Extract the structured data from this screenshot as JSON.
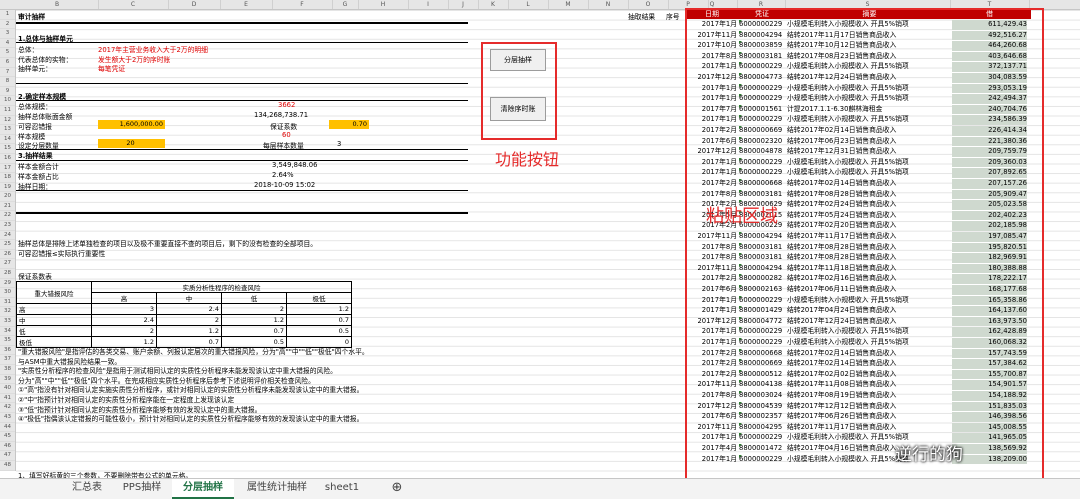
{
  "columns_left": [
    "B",
    "C",
    "D",
    "E",
    "F",
    "G",
    "H",
    "I",
    "J",
    "K",
    "L",
    "M",
    "N",
    "O",
    "P"
  ],
  "columns_right": [
    "Q",
    "R",
    "S",
    "T"
  ],
  "rows": [
    "1",
    "2",
    "3",
    "4",
    "5",
    "6",
    "7",
    "8",
    "9",
    "10",
    "11",
    "12",
    "13",
    "14",
    "15",
    "16",
    "17",
    "18",
    "19",
    "20",
    "21",
    "22",
    "23",
    "24",
    "25",
    "26",
    "27",
    "28",
    "29",
    "30",
    "31",
    "32",
    "33",
    "34",
    "35",
    "36",
    "37",
    "38",
    "39",
    "40",
    "41",
    "42",
    "43",
    "44",
    "45",
    "46",
    "47",
    "48"
  ],
  "left": {
    "title": "审计抽样",
    "sec1": "1.总体与抽样单元",
    "pop_label": "总体：",
    "pop_value": "2017年主营业务收入大于2万的明细",
    "rep_label": "代表总体的实物：",
    "rep_value": "发生额大于2万的序时账",
    "unit_label": "抽样单元：",
    "unit_value": "每笔凭证",
    "sec2": "2.确定样本规模",
    "size_label": "总体规模：",
    "size_value": "3662",
    "amount_label": "抽样总体账面金额",
    "amount_value": "134,268,738.71",
    "tol_label": "可容忍错报",
    "tol_value": "1,600,000.00",
    "conf_label": "保证系数",
    "conf_value": "0.70",
    "sample_label": "样本规模",
    "sample_value": "60",
    "layers_label": "设定分层数量",
    "layers_value": "20",
    "per_layer_label": "每层样本数量",
    "per_layer_value": "3",
    "sec3": "3.抽样结果",
    "total_label": "样本金额合计",
    "total_value": "3,549,848.06",
    "ratio_label": "样本金额占比",
    "ratio_value": "2.64%",
    "date_label": "抽样日期：",
    "date_value": "2018-10-09 15:02",
    "note1": "抽样总体是排除上述单独检查的项目以及极不重要直接不查的项目后，剩下的没有检查的全部项目。",
    "note2": "可容忍错报≤实际执行重要性",
    "table_caption": "保证系数表",
    "risk": {
      "row_header": "重大错报风险",
      "group_header": "实质分析性程序的检查风险",
      "cols": [
        "高",
        "中",
        "低",
        "极低"
      ],
      "rows": [
        {
          "name": "高",
          "vals": [
            "3",
            "2.4",
            "2",
            "1.2"
          ]
        },
        {
          "name": "中",
          "vals": [
            "2.4",
            "2",
            "1.2",
            "0.7"
          ]
        },
        {
          "name": "低",
          "vals": [
            "2",
            "1.2",
            "0.7",
            "0.5"
          ]
        },
        {
          "name": "极低",
          "vals": [
            "1.2",
            "0.7",
            "0.5",
            "0"
          ]
        }
      ]
    },
    "notes": [
      "\"重大错报风险\"是指评估的各类交易、账户余额、列报认定层次的重大错报风险，分为\"高\"\"中\"\"低\"\"极低\"四个水平。",
      "与ASM中重大错报风险结果一致。",
      "\"实质性分析程序的检查风险\"是指用于测试相同认定的实质性分析程序未能发现该认定中重大错报的风险。",
      "分为\"高\"\"中\"\"低\"\"极低\"四个水平。在完成相应实质性分析程序后参考下述说明评价相关检查风险。",
      "①\"高\"指没有针对相同认定实施实质性分析程序，或针对相同认定的实质性分析程序未能发现该认定中的重大错报。",
      "②\"中\"指预计针对相同认定的实质性分析程序能在一定程度上发现该认定",
      "③\"低\"指预计针对相同认定的实质性分析程序能够有效的发现认定中的重大错报。",
      "④\"极低\"指偶该认定错报的可能性极小，预计针对相同认定的实质性分析程序能够有效的发现该认定中的重大错报。"
    ],
    "bottom_note": "1、填写好标黄的三个参数，不要删除带有公式的单元格。"
  },
  "buttons": {
    "layered": "分层抽样",
    "clear": "清除序时账"
  },
  "annotations": {
    "buttons_label": "功能按钮",
    "paste_label": "粘贴区域"
  },
  "result_header": {
    "result": "抽取结果",
    "seq": "序号"
  },
  "journal": {
    "headers": [
      "日期",
      "凭证",
      "摘要",
      "借"
    ],
    "rows": [
      {
        "date": "2017年1月",
        "voucher": "6000000229",
        "summary": "小规模毛利转入小规模收入 开具5%销项",
        "amount": "611,429.43"
      },
      {
        "date": "2017年11月",
        "voucher": "8800004294",
        "summary": "结转2017年11月17日销售商品收入",
        "amount": "492,516.27"
      },
      {
        "date": "2017年10月",
        "voucher": "8800003859",
        "summary": "结转2017年10月12日销售商品收入",
        "amount": "464,260.68"
      },
      {
        "date": "2017年8月",
        "voucher": "8800003181",
        "summary": "结转2017年08月23日销售商品收入",
        "amount": "403,646.68"
      },
      {
        "date": "2017年1月",
        "voucher": "6000000229",
        "summary": "小规模毛利转入小规模收入 开具5%销项",
        "amount": "372,137.71"
      },
      {
        "date": "2017年12月",
        "voucher": "8800004773",
        "summary": "结转2017年12月24日销售商品收入",
        "amount": "304,083.59"
      },
      {
        "date": "2017年1月",
        "voucher": "6000000229",
        "summary": "小规模毛利转入小规模收入 开具5%销项",
        "amount": "293,053.19"
      },
      {
        "date": "2017年1月",
        "voucher": "6000000229",
        "summary": "小规模毛利转入小规模收入 开具5%销项",
        "amount": "242,494.37"
      },
      {
        "date": "2017年7月",
        "voucher": "6000001561",
        "summary": "计提2017.1.1-6.30麒林海租金",
        "amount": "240,704.76"
      },
      {
        "date": "2017年1月",
        "voucher": "6000000229",
        "summary": "小规模毛利转入小规模收入 开具5%销项",
        "amount": "234,586.39"
      },
      {
        "date": "2017年2月",
        "voucher": "8800000669",
        "summary": "结转2017年02月14日销售商品收入",
        "amount": "226,414.34"
      },
      {
        "date": "2017年6月",
        "voucher": "8800002320",
        "summary": "结转2017年06月23日销售商品收入",
        "amount": "221,380.36"
      },
      {
        "date": "2017年12月",
        "voucher": "8800004878",
        "summary": "结转2017年12月31日销售商品收入",
        "amount": "209,759.79"
      },
      {
        "date": "2017年1月",
        "voucher": "6000000229",
        "summary": "小规模毛利转入小规模收入 开具5%销项",
        "amount": "209,360.03"
      },
      {
        "date": "2017年1月",
        "voucher": "6000000229",
        "summary": "小规模毛利转入小规模收入 开具5%销项",
        "amount": "207,892.65"
      },
      {
        "date": "2017年2月",
        "voucher": "8800000668",
        "summary": "结转2017年02月14日销售商品收入",
        "amount": "207,157.26"
      },
      {
        "date": "2017年8月",
        "voucher": "8800003181",
        "summary": "结转2017年08月28日销售商品收入",
        "amount": "205,909.47"
      },
      {
        "date": "2017年2月",
        "voucher": "8800000629",
        "summary": "结转2017年02月24日销售商品收入",
        "amount": "205,023.58"
      },
      {
        "date": "2017年5月",
        "voucher": "8800002015",
        "summary": "结转2017年05月24日销售商品收入",
        "amount": "202,402.23"
      },
      {
        "date": "2017年2月",
        "voucher": "6000000229",
        "summary": "结转2017年02月20日销售商品收入",
        "amount": "202,185.98"
      },
      {
        "date": "2017年11月",
        "voucher": "8800004294",
        "summary": "结转2017年11月17日销售商品收入",
        "amount": "197,085.47"
      },
      {
        "date": "2017年8月",
        "voucher": "8800003181",
        "summary": "结转2017年08月28日销售商品收入",
        "amount": "195,820.51"
      },
      {
        "date": "2017年8月",
        "voucher": "8800003181",
        "summary": "结转2017年08月28日销售商品收入",
        "amount": "182,969.91"
      },
      {
        "date": "2017年11月",
        "voucher": "8800004294",
        "summary": "结转2017年11月18日销售商品收入",
        "amount": "180,388.88"
      },
      {
        "date": "2017年2月",
        "voucher": "8800000282",
        "summary": "结转2017年02月16日销售商品收入",
        "amount": "178,222.17"
      },
      {
        "date": "2017年6月",
        "voucher": "8800002163",
        "summary": "结转2017年06月11日销售商品收入",
        "amount": "168,177.68"
      },
      {
        "date": "2017年1月",
        "voucher": "6000000229",
        "summary": "小规模毛利转入小规模收入 开具5%销项",
        "amount": "165,358.86"
      },
      {
        "date": "2017年1月",
        "voucher": "8800001429",
        "summary": "结转2017年04月24日销售商品收入",
        "amount": "164,137.60"
      },
      {
        "date": "2017年12月",
        "voucher": "8800004772",
        "summary": "结转2017年12月24日销售商品收入",
        "amount": "163,973.50"
      },
      {
        "date": "2017年1月",
        "voucher": "6000000229",
        "summary": "小规模毛利转入小规模收入 开具5%销项",
        "amount": "162,428.89"
      },
      {
        "date": "2017年1月",
        "voucher": "6000000229",
        "summary": "小规模毛利转入小规模收入 开具5%销项",
        "amount": "160,068.32"
      },
      {
        "date": "2017年2月",
        "voucher": "8800000668",
        "summary": "结转2017年02月14日销售商品收入",
        "amount": "157,743.59"
      },
      {
        "date": "2017年2月",
        "voucher": "8800000669",
        "summary": "结转2017年02月14日销售商品收入",
        "amount": "157,384.62"
      },
      {
        "date": "2017年2月",
        "voucher": "8800000512",
        "summary": "结转2017年02月02日销售商品收入",
        "amount": "155,700.87"
      },
      {
        "date": "2017年11月",
        "voucher": "8800004138",
        "summary": "结转2017年11月08日销售商品收入",
        "amount": "154,901.57"
      },
      {
        "date": "2017年8月",
        "voucher": "8800003024",
        "summary": "结转2017年08月19日销售商品收入",
        "amount": "154,188.92"
      },
      {
        "date": "2017年12月",
        "voucher": "8800004539",
        "summary": "结转2017年12月12日销售商品收入",
        "amount": "151,835.03"
      },
      {
        "date": "2017年6月",
        "voucher": "8800002357",
        "summary": "结转2017年06月26日销售商品收入",
        "amount": "146,398.56"
      },
      {
        "date": "2017年11月",
        "voucher": "8800004295",
        "summary": "结转2017年11月17日销售商品收入",
        "amount": "145,008.55"
      },
      {
        "date": "2017年1月",
        "voucher": "6000000229",
        "summary": "小规模毛利转入小规模收入 开具5%销项",
        "amount": "141,965.05"
      },
      {
        "date": "2017年4月",
        "voucher": "8800001472",
        "summary": "结转2017年04月16日销售商品收入",
        "amount": "138,569.92"
      },
      {
        "date": "2017年1月",
        "voucher": "6000000229",
        "summary": "小规模毛利转入小规模收入 开具5%销项",
        "amount": "138,209.00"
      }
    ]
  },
  "tabs": [
    "汇总表",
    "PPS抽样",
    "分层抽样",
    "属性统计抽样",
    "sheet1"
  ],
  "active_tab": "分层抽样",
  "add_sheet_icon": "plus-circle-icon",
  "watermark": "逆行的狗",
  "colors": {
    "accent_red": "#e52b2b",
    "header_red": "#c00000",
    "param_yellow": "#ffc000",
    "excel_green": "#217346"
  }
}
